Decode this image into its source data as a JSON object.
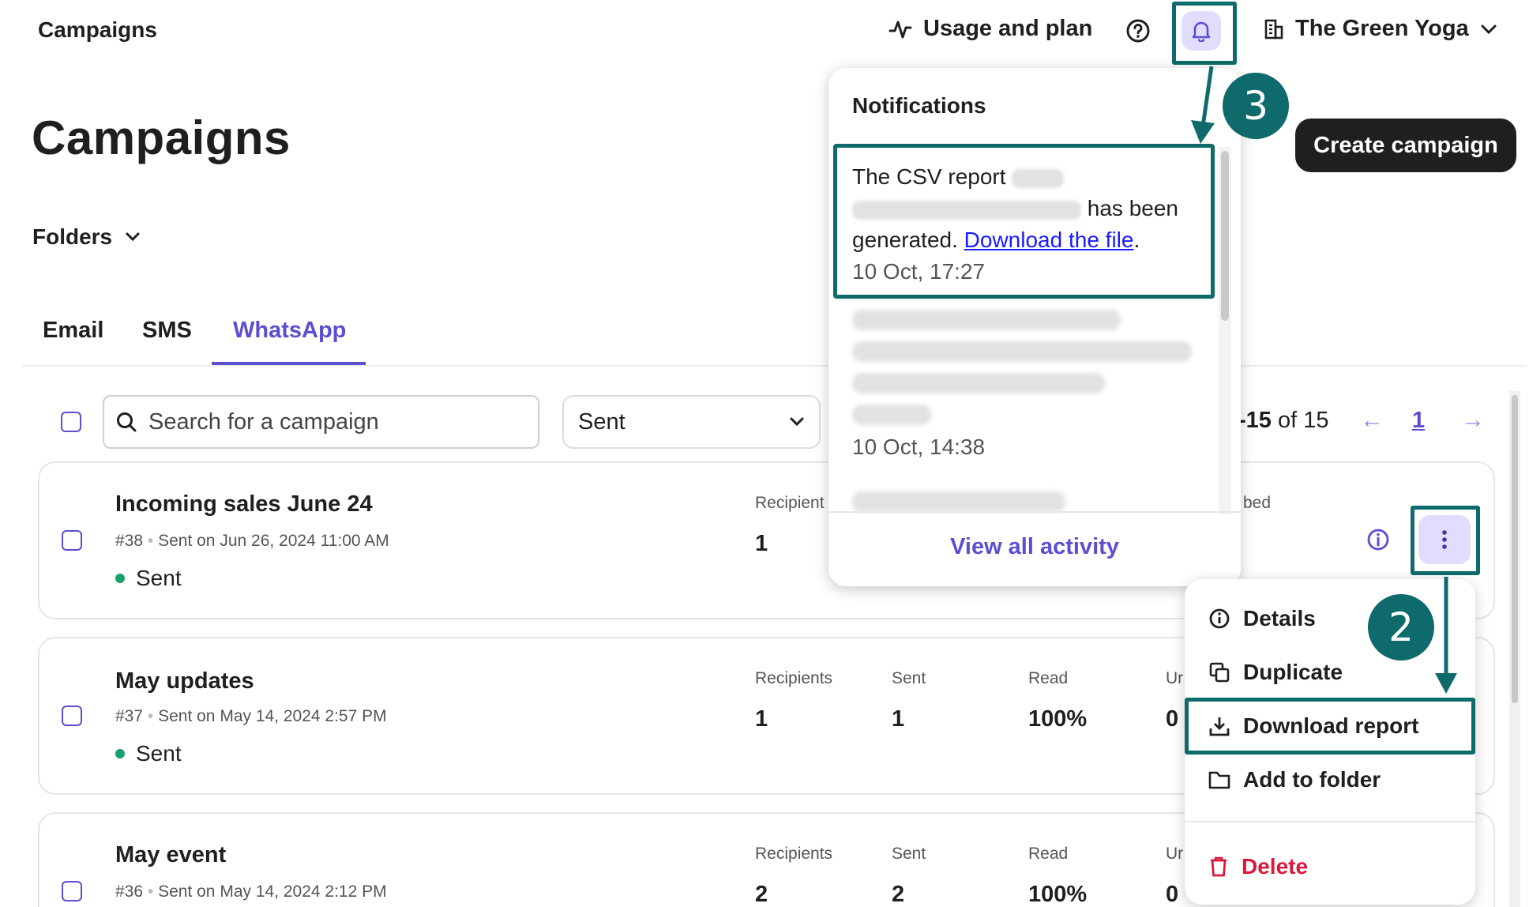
{
  "header": {
    "breadcrumb": "Campaigns",
    "usage_label": "Usage and plan",
    "org_name": "The Green Yoga"
  },
  "page": {
    "title": "Campaigns",
    "create_button": "Create campaign",
    "folders_label": "Folders"
  },
  "tabs": [
    {
      "label": "Email",
      "active": false
    },
    {
      "label": "SMS",
      "active": false
    },
    {
      "label": "WhatsApp",
      "active": true
    }
  ],
  "toolbar": {
    "search_placeholder": "Search for a campaign",
    "status_filter": "Sent",
    "pager_range": "-15",
    "pager_of": "of 15",
    "current_page": "1"
  },
  "campaigns": [
    {
      "name": "Incoming sales June 24",
      "id": "#38",
      "sent_on": "Sent on Jun 26, 2024 11:00 AM",
      "status": "Sent",
      "recipients_label": "Recipient",
      "recipients": "1",
      "partial_col_label": "bed"
    },
    {
      "name": "May updates",
      "id": "#37",
      "sent_on": "Sent on May 14, 2024 2:57 PM",
      "status": "Sent",
      "recipients_label": "Recipients",
      "recipients": "1",
      "sent_label": "Sent",
      "sent": "1",
      "read_label": "Read",
      "read": "100%",
      "partial_label": "Ur",
      "partial_value": "0"
    },
    {
      "name": "May event",
      "id": "#36",
      "sent_on": "Sent on May 14, 2024 2:12 PM",
      "recipients_label": "Recipients",
      "recipients": "2",
      "sent_label": "Sent",
      "sent": "2",
      "read_label": "Read",
      "read": "100%",
      "partial_label": "Ur",
      "partial_value": "0"
    }
  ],
  "notifications": {
    "title": "Notifications",
    "item1": {
      "text_a": "The CSV report",
      "text_b": "has been",
      "text_c": "generated.",
      "link": "Download the file",
      "period": ".",
      "time": "10 Oct, 17:27"
    },
    "item2": {
      "time": "10 Oct, 14:38"
    },
    "view_all": "View all activity"
  },
  "actions_menu": {
    "details": "Details",
    "duplicate": "Duplicate",
    "download_report": "Download report",
    "add_to_folder": "Add to folder",
    "delete": "Delete"
  },
  "callouts": {
    "step2": "2",
    "step3": "3"
  },
  "colors": {
    "accent": "#5b4fcf",
    "callout": "#0f6b6b",
    "delete": "#d91a3b",
    "status_sent": "#18a06b"
  }
}
